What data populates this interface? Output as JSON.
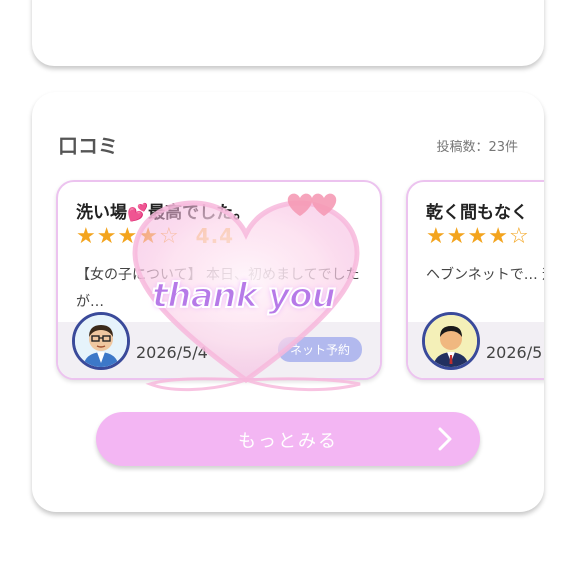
{
  "section": {
    "title": "口コミ",
    "post_count": "投稿数：23件"
  },
  "reviews": [
    {
      "title": "洗い場💕最高でした。",
      "stars": 4,
      "rating": "4.4",
      "body": "【女の子について】 本日、初めましてでしたが…",
      "date": "2026/5/4",
      "badge": "ネット予約"
    },
    {
      "title": "乾く間もなく",
      "stars": 4,
      "body": "ヘブンネットで… 遊んでいただい…",
      "date": "2026/5"
    }
  ],
  "more_button": {
    "label": "もっとみる"
  },
  "overlay_text": "thank you",
  "colors": {
    "accent": "#f3b6f3",
    "star": "#f3a41e",
    "badge": "#b2b9ee"
  }
}
